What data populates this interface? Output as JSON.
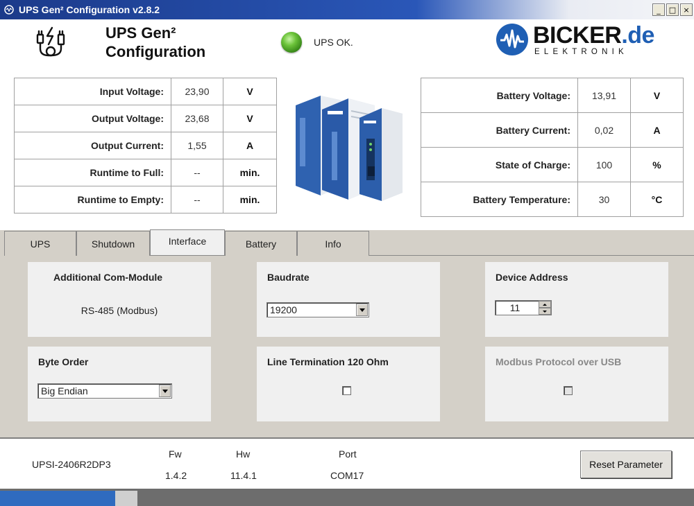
{
  "window": {
    "title": "UPS Gen² Configuration v2.8.2",
    "minimize_glyph": "_",
    "maximize_glyph": "□",
    "close_glyph": "×"
  },
  "header": {
    "title_line1": "UPS Gen²",
    "title_line2": "Configuration",
    "status_text": "UPS OK.",
    "status_color": "#4caf2a",
    "brand_name": "BICKER",
    "brand_tld": ".de",
    "brand_sub": "ELEKTRONIK",
    "brand_color": "#1f5fb4"
  },
  "left_table": [
    {
      "label": "Input Voltage:",
      "value": "23,90",
      "unit": "V"
    },
    {
      "label": "Output Voltage:",
      "value": "23,68",
      "unit": "V"
    },
    {
      "label": "Output Current:",
      "value": "1,55",
      "unit": "A"
    },
    {
      "label": "Runtime to Full:",
      "value": "--",
      "unit": "min."
    },
    {
      "label": "Runtime to Empty:",
      "value": "--",
      "unit": "min."
    }
  ],
  "right_table": [
    {
      "label": "Battery Voltage:",
      "value": "13,91",
      "unit": "V"
    },
    {
      "label": "Battery Current:",
      "value": "0,02",
      "unit": "A"
    },
    {
      "label": "State of Charge:",
      "value": "100",
      "unit": "%"
    },
    {
      "label": "Battery Temperature:",
      "value": "30",
      "unit": "°C"
    }
  ],
  "tabs": [
    {
      "label": "UPS"
    },
    {
      "label": "Shutdown"
    },
    {
      "label": "Interface",
      "active": true
    },
    {
      "label": "Battery"
    },
    {
      "label": "Info"
    }
  ],
  "interface": {
    "com_module": {
      "title": "Additional Com-Module",
      "value": "RS-485 (Modbus)"
    },
    "baudrate": {
      "title": "Baudrate",
      "selected": "19200"
    },
    "device_address": {
      "title": "Device Address",
      "value": "11"
    },
    "byte_order": {
      "title": "Byte Order",
      "selected": "Big Endian"
    },
    "line_termination": {
      "title": "Line Termination 120 Ohm",
      "checked": false
    },
    "modbus_usb": {
      "title": "Modbus Protocol over USB",
      "checked": false,
      "disabled": true
    }
  },
  "footer": {
    "model": "UPSI-2406R2DP3",
    "fw_label": "Fw",
    "fw_value": "1.4.2",
    "hw_label": "Hw",
    "hw_value": "11.4.1",
    "port_label": "Port",
    "port_value": "COM17",
    "reset_label": "Reset Parameter"
  }
}
